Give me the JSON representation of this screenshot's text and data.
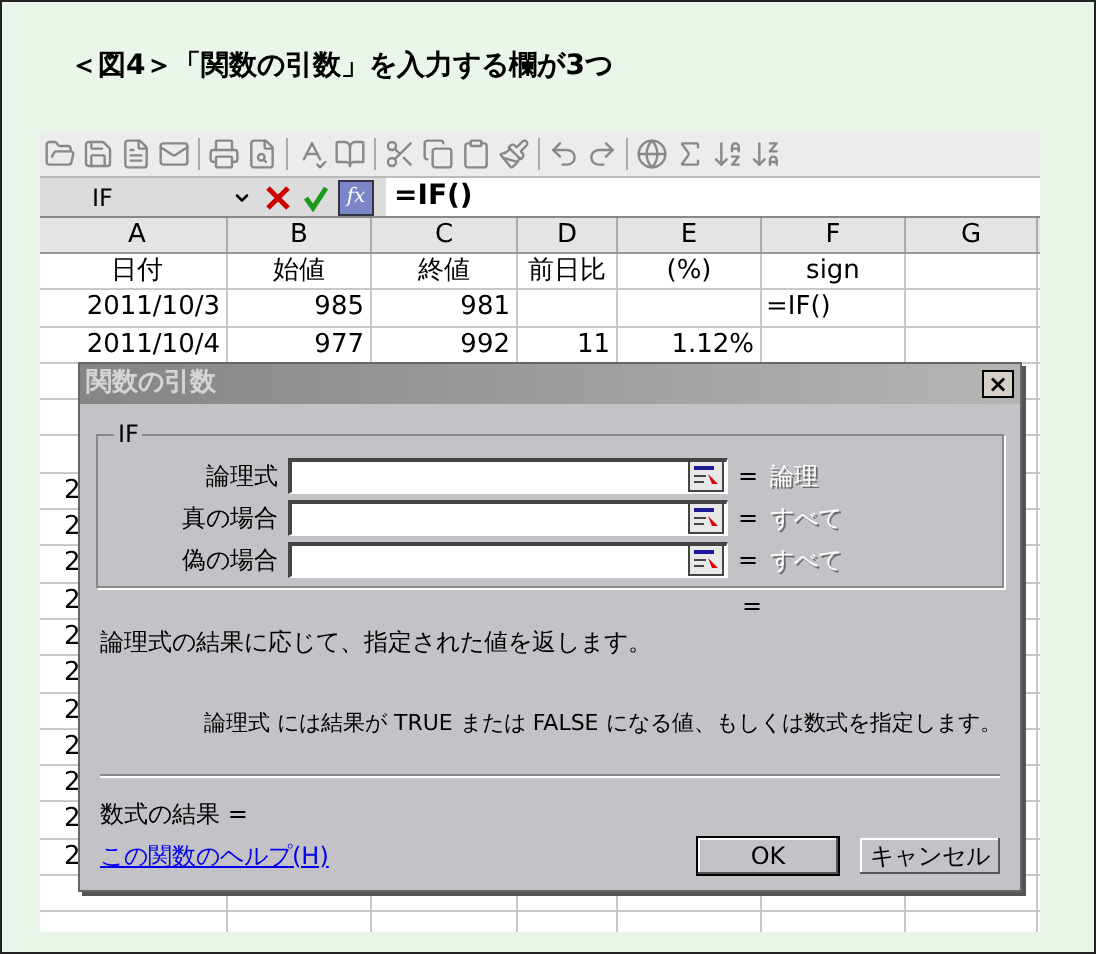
{
  "title": "＜図4＞「関数の引数」を入力する欄が3つ",
  "formula_bar": {
    "name_box": "IF",
    "fx": "fx",
    "formula": "=IF()"
  },
  "sheet": {
    "columns": [
      "A",
      "B",
      "C",
      "D",
      "E",
      "F",
      "G"
    ],
    "rows": [
      {
        "kind": "header",
        "cells": [
          "日付",
          "始値",
          "終値",
          "前日比",
          "(%)",
          "sign",
          null
        ]
      },
      {
        "kind": "data",
        "cells": [
          "2011/10/3",
          "985",
          "981",
          null,
          null,
          "=IF()",
          null
        ]
      },
      {
        "kind": "data",
        "cells": [
          "2011/10/4",
          "977",
          "992",
          "11",
          "1.12%",
          null,
          null
        ]
      },
      {
        "kind": "covered"
      },
      {
        "kind": "covered"
      },
      {
        "kind": "covered"
      },
      {
        "kind": "covered",
        "cells": [
          "2"
        ]
      },
      {
        "kind": "covered",
        "cells": [
          "2"
        ]
      },
      {
        "kind": "covered",
        "cells": [
          "2"
        ]
      },
      {
        "kind": "covered",
        "cells": [
          "2"
        ]
      },
      {
        "kind": "covered",
        "cells": [
          "2"
        ]
      },
      {
        "kind": "covered",
        "cells": [
          "2"
        ]
      },
      {
        "kind": "covered",
        "cells": [
          "2"
        ]
      },
      {
        "kind": "covered",
        "cells": [
          "2"
        ]
      },
      {
        "kind": "covered",
        "cells": [
          "2"
        ]
      },
      {
        "kind": "covered",
        "cells": [
          "2"
        ]
      },
      {
        "kind": "covered",
        "cells": [
          "2"
        ]
      },
      {
        "kind": "covered"
      },
      {
        "kind": "covered"
      }
    ]
  },
  "dialog": {
    "title": "関数の引数",
    "close": "×",
    "group": "IF",
    "arguments": [
      {
        "label": "論理式",
        "hint": "論理"
      },
      {
        "label": "真の場合",
        "hint": "すべて"
      },
      {
        "label": "偽の場合",
        "hint": "すべて"
      }
    ],
    "equals": "=",
    "result_equals": "=",
    "description": "論理式の結果に応じて、指定された値を返します。",
    "argument_help": "論理式 には結果が TRUE または FALSE になる値、もしくは数式を指定します。",
    "formula_result": "数式の結果 =",
    "help_link": "この関数のヘルプ(H)",
    "buttons": [
      {
        "label": "OK",
        "default": true
      },
      {
        "label": "キャンセル",
        "default": false
      }
    ]
  }
}
